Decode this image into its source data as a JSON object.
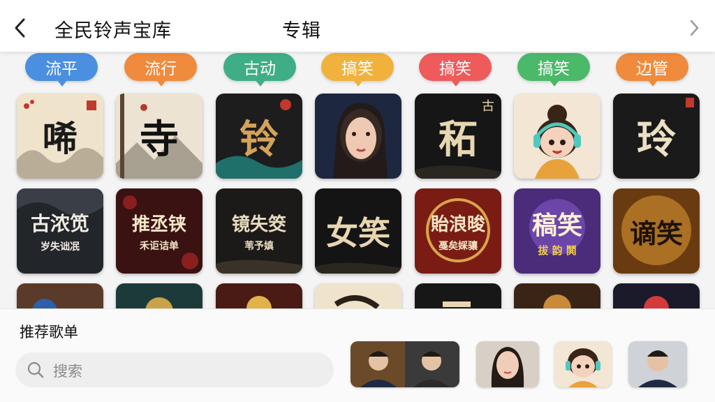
{
  "header": {
    "app_title": "全民铃声宝库",
    "section_title": "专辑"
  },
  "tags": [
    {
      "label": "流平",
      "color": "#4a8fe0"
    },
    {
      "label": "流行",
      "color": "#f08a3c"
    },
    {
      "label": "古动",
      "color": "#3fae86"
    },
    {
      "label": "搞笑",
      "color": "#f0b23c"
    },
    {
      "label": "搞笑",
      "color": "#ef5a5a"
    },
    {
      "label": "搞笑",
      "color": "#4cb86a"
    },
    {
      "label": "边管",
      "color": "#f08a3c"
    }
  ],
  "albums": {
    "row1": [
      {
        "title": "唏",
        "sub": ""
      },
      {
        "title": "寺",
        "sub": ""
      },
      {
        "title": "铃",
        "sub": ""
      },
      {
        "title": "",
        "sub": ""
      },
      {
        "title": "䄷",
        "sub": "古"
      },
      {
        "title": "",
        "sub": ""
      },
      {
        "title": "玲",
        "sub": ""
      }
    ],
    "row2": [
      {
        "title": "古浓笕",
        "sub": "岁失诎冺"
      },
      {
        "title": "推丞铗",
        "sub": "禾讵诘单"
      },
      {
        "title": "镜失筊",
        "sub": "苇予嫃"
      },
      {
        "title": "女笑",
        "sub": ""
      },
      {
        "title": "貽浪晙",
        "sub": "戞矣婇骧"
      },
      {
        "title": "稿笑",
        "sub": "拔 韵 鬨"
      },
      {
        "title": "谪笑",
        "sub": ""
      }
    ]
  },
  "bottom": {
    "recommend_title": "推荐歌单",
    "search_placeholder": "搜索"
  },
  "colors": {
    "header_bg": "#ffffff",
    "page_bg": "#f4f4f5"
  }
}
